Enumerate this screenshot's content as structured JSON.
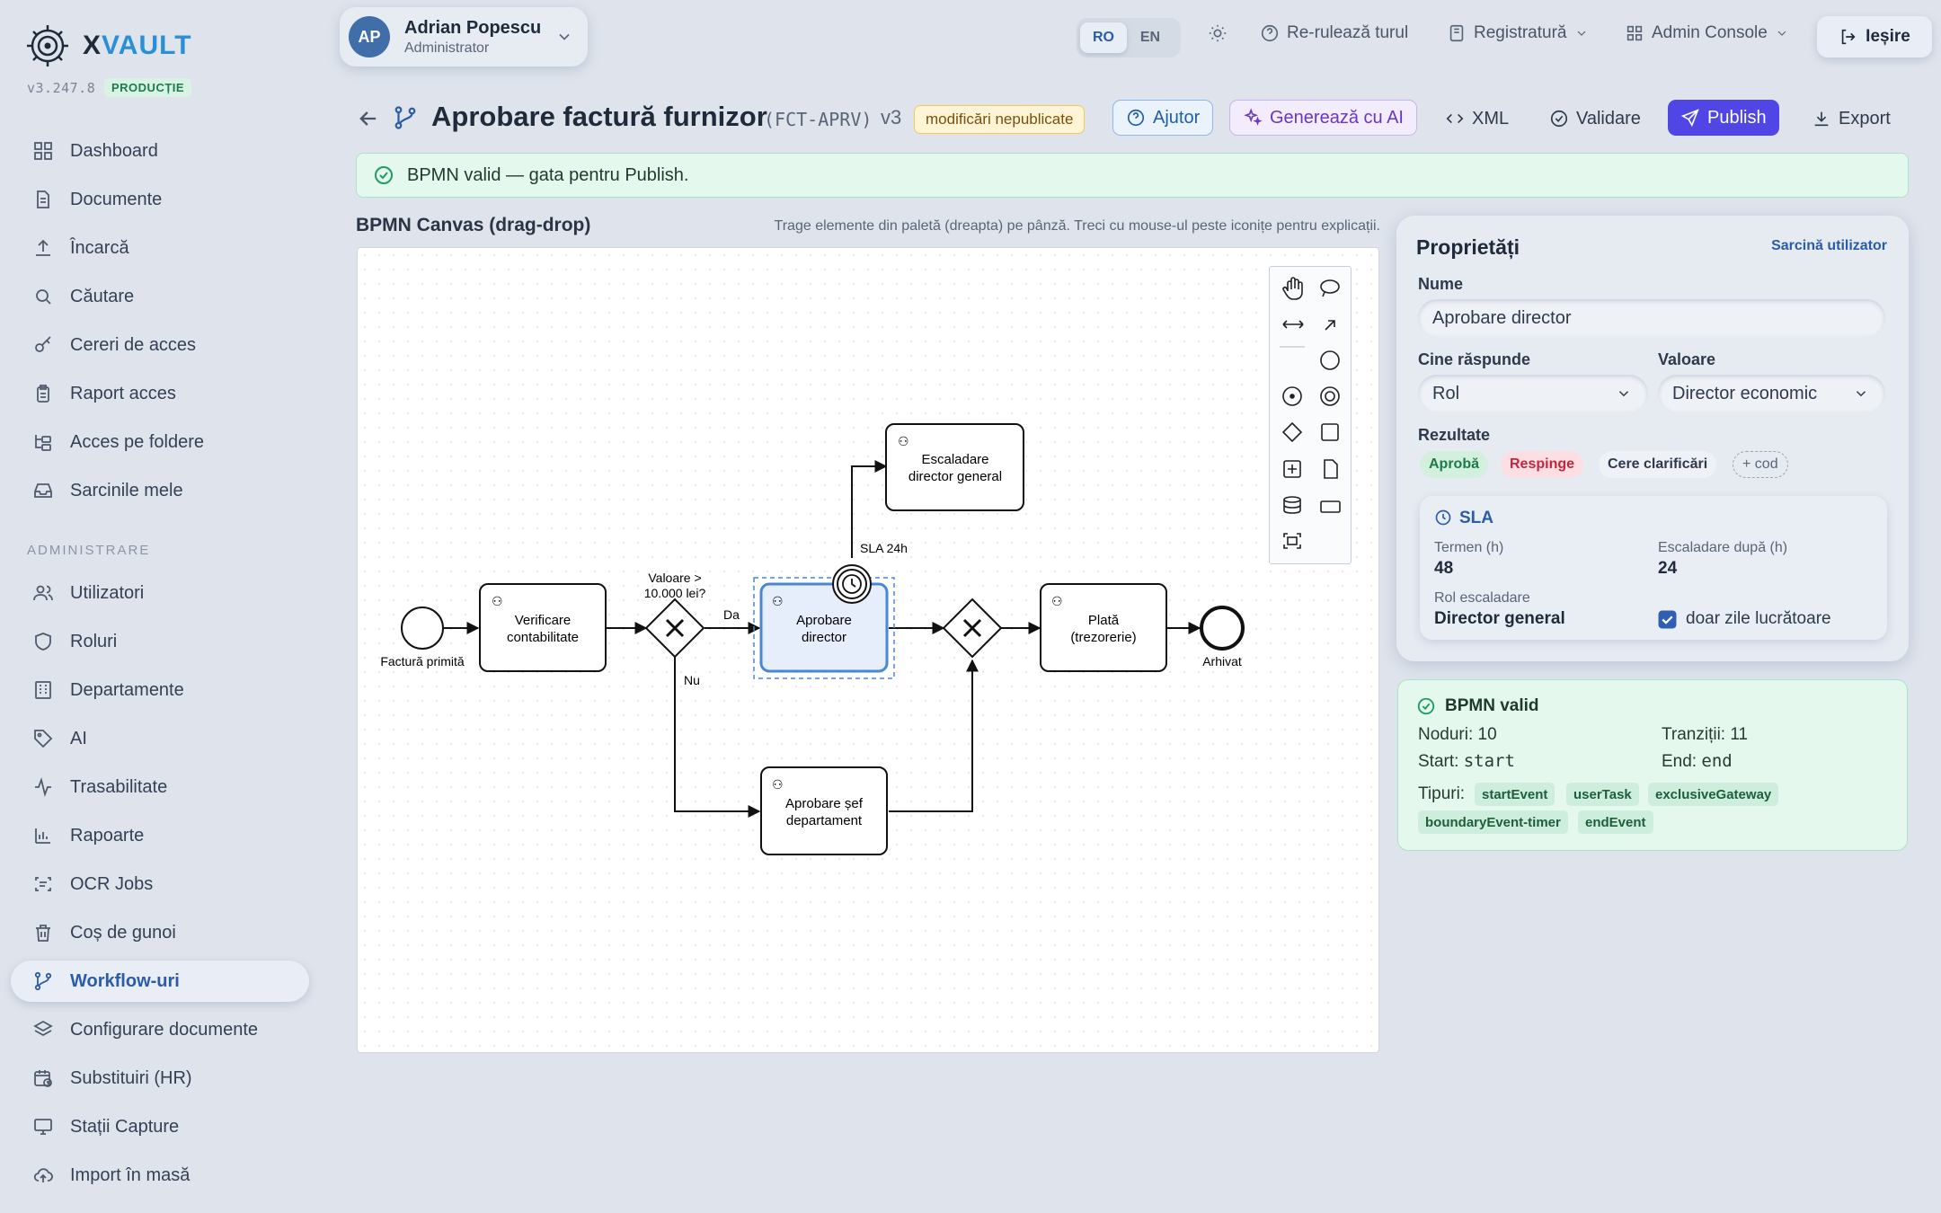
{
  "brand": {
    "name_a": "X",
    "name_b": "VAULT",
    "version": "v3.247.8",
    "env": "PRODUCȚIE"
  },
  "sidebar": {
    "items": [
      {
        "label": "Dashboard",
        "icon": "dashboard-icon"
      },
      {
        "label": "Documente",
        "icon": "document-icon"
      },
      {
        "label": "Încarcă",
        "icon": "upload-icon"
      },
      {
        "label": "Căutare",
        "icon": "search-icon"
      },
      {
        "label": "Cereri de acces",
        "icon": "key-icon"
      },
      {
        "label": "Raport acces",
        "icon": "clipboard-icon"
      },
      {
        "label": "Acces pe foldere",
        "icon": "folder-tree-icon"
      },
      {
        "label": "Sarcinile mele",
        "icon": "inbox-icon"
      }
    ],
    "section": "ADMINISTRARE",
    "admin_items": [
      {
        "label": "Utilizatori",
        "icon": "users-icon"
      },
      {
        "label": "Roluri",
        "icon": "shield-icon"
      },
      {
        "label": "Departamente",
        "icon": "building-icon"
      },
      {
        "label": "AI",
        "icon": "tag-icon"
      },
      {
        "label": "Trasabilitate",
        "icon": "activity-icon"
      },
      {
        "label": "Rapoarte",
        "icon": "bar-chart-icon"
      },
      {
        "label": "OCR Jobs",
        "icon": "scan-text-icon"
      },
      {
        "label": "Coș de gunoi",
        "icon": "trash-icon"
      },
      {
        "label": "Workflow-uri",
        "icon": "workflow-icon",
        "active": true
      },
      {
        "label": "Configurare documente",
        "icon": "layers-icon"
      },
      {
        "label": "Substituiri (HR)",
        "icon": "calendar-clock-icon"
      },
      {
        "label": "Stații Capture",
        "icon": "monitor-icon"
      },
      {
        "label": "Import în masă",
        "icon": "cloud-upload-icon"
      }
    ]
  },
  "topbar": {
    "user": {
      "initials": "AP",
      "name": "Adrian Popescu",
      "role": "Administrator"
    },
    "lang": [
      "RO",
      "EN"
    ],
    "tour": "Re-rulează turul",
    "registry": "Registratură",
    "admin_console": "Admin Console",
    "logout": "Ieșire"
  },
  "workflow": {
    "title": "Aprobare factură furnizor",
    "code": "(FCT-APRV)",
    "version": "v3",
    "status_badge": "modificări nepublicate",
    "buttons": {
      "help": "Ajutor",
      "ai": "Generează cu AI",
      "xml": "XML",
      "validate": "Validare",
      "publish": "Publish",
      "export": "Export"
    }
  },
  "alert": "BPMN valid — gata pentru Publish.",
  "canvas": {
    "title": "BPMN Canvas (drag-drop)",
    "hint": "Trage elemente din paletă (dreapta) pe pânză. Treci cu mouse-ul peste iconițe pentru explicații.",
    "nodes": {
      "start": "Factură primită",
      "verify_1": "Verificare",
      "verify_2": "contabilitate",
      "gw_1": "Valoare >",
      "gw_2": "10.000 lei?",
      "yes": "Da",
      "no": "Nu",
      "director_1": "Aprobare",
      "director_2": "director",
      "sla": "SLA 24h",
      "esc_1": "Escaladare",
      "esc_2": "director general",
      "dept_1": "Aprobare șef",
      "dept_2": "departament",
      "pay_1": "Plată",
      "pay_2": "(trezorerie)",
      "end": "Arhivat"
    }
  },
  "properties": {
    "title": "Proprietăți",
    "type": "Sarcină utilizator",
    "name_label": "Nume",
    "name_value": "Aprobare director",
    "who_label": "Cine răspunde",
    "who_value": "Rol",
    "value_label": "Valoare",
    "value_value": "Director economic",
    "results_label": "Rezultate",
    "results": [
      "Aprobă",
      "Respinge",
      "Cere clarificări"
    ],
    "add_code": "+ cod",
    "sla": {
      "title": "SLA",
      "term_label": "Termen (h)",
      "term_value": "48",
      "esc_label": "Escaladare după (h)",
      "esc_value": "24",
      "role_label": "Rol escaladare",
      "role_value": "Director general",
      "workdays_label": "doar zile lucrătoare",
      "workdays_checked": true
    }
  },
  "validation": {
    "title": "BPMN valid",
    "nodes": "Noduri: 10",
    "transitions": "Tranziții: 11",
    "start_label": "Start:",
    "start_value": "start",
    "end_label": "End:",
    "end_value": "end",
    "types_label": "Tipuri:",
    "types": [
      "startEvent",
      "userTask",
      "exclusiveGateway",
      "boundaryEvent-timer",
      "endEvent"
    ]
  },
  "colors": {
    "accent": "#4f46e5",
    "primary_link": "#2a5ca8",
    "success": "#1f9d5f",
    "background": "#dfe4ec"
  }
}
